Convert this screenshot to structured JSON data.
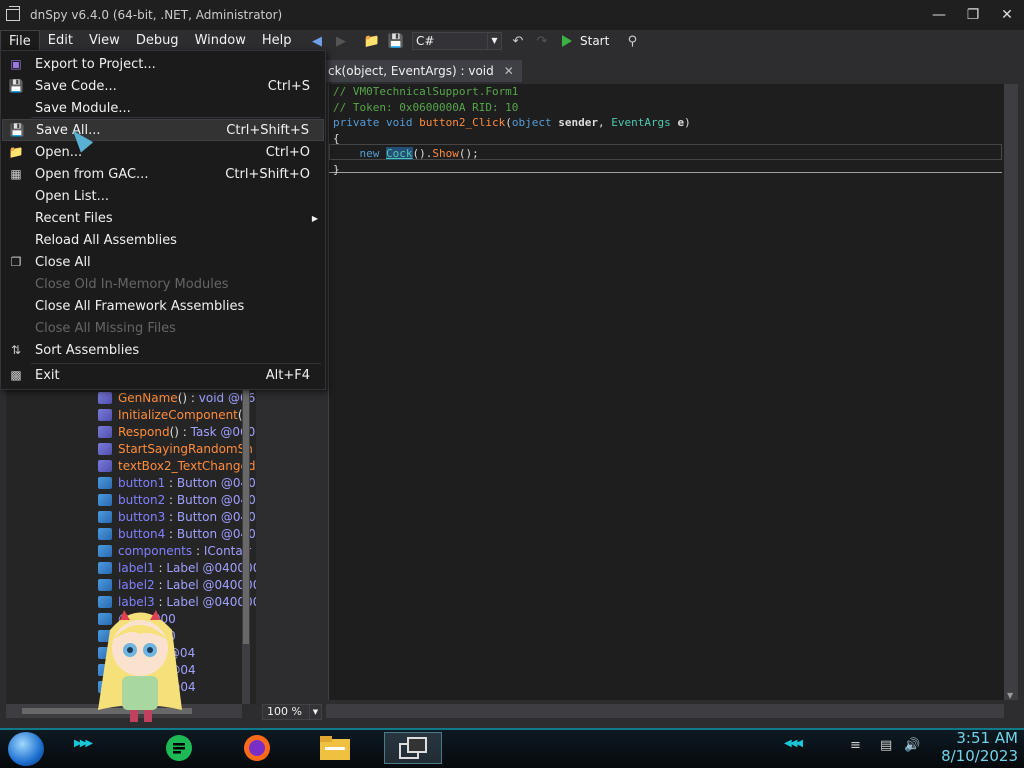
{
  "window": {
    "title": "dnSpy v6.4.0 (64-bit, .NET, Administrator)"
  },
  "menubar": [
    "File",
    "Edit",
    "View",
    "Debug",
    "Window",
    "Help"
  ],
  "toolbar": {
    "language": "C#",
    "start_label": "Start"
  },
  "document_tab": {
    "label": "ck(object, EventArgs) : void",
    "close": "✕"
  },
  "file_menu": [
    {
      "label": "Export to Project...",
      "shortcut": "",
      "icon": "export-icon",
      "state": "normal"
    },
    {
      "label": "Save Code...",
      "shortcut": "Ctrl+S",
      "icon": "save-icon",
      "state": "normal"
    },
    {
      "label": "Save Module...",
      "shortcut": "",
      "icon": "",
      "state": "normal"
    },
    {
      "label": "Save All...",
      "shortcut": "Ctrl+Shift+S",
      "icon": "save-all-icon",
      "state": "hover"
    },
    {
      "label": "Open...",
      "shortcut": "Ctrl+O",
      "icon": "open-folder-icon",
      "state": "normal"
    },
    {
      "label": "Open from GAC...",
      "shortcut": "Ctrl+Shift+O",
      "icon": "library-icon",
      "state": "normal"
    },
    {
      "label": "Open List...",
      "shortcut": "",
      "icon": "",
      "state": "normal"
    },
    {
      "label": "Recent Files",
      "shortcut": "",
      "icon": "",
      "state": "submenu"
    },
    {
      "label": "Reload All Assemblies",
      "shortcut": "",
      "icon": "",
      "state": "normal"
    },
    {
      "label": "Close All",
      "shortcut": "",
      "icon": "close-all-icon",
      "state": "normal"
    },
    {
      "label": "Close Old In-Memory Modules",
      "shortcut": "",
      "icon": "",
      "state": "disabled"
    },
    {
      "label": "Close All Framework Assemblies",
      "shortcut": "",
      "icon": "",
      "state": "normal"
    },
    {
      "label": "Close All Missing Files",
      "shortcut": "",
      "icon": "",
      "state": "disabled"
    },
    {
      "label": "Sort Assemblies",
      "shortcut": "",
      "icon": "sort-icon",
      "state": "normal"
    },
    {
      "label": "Exit",
      "shortcut": "Alt+F4",
      "icon": "exit-icon",
      "state": "normal"
    }
  ],
  "code": {
    "line1": "// VM0TechnicalSupport.Form1",
    "line2": "// Token: 0x0600000A RID: 10",
    "kw_private": "private",
    "kw_void": "void",
    "method_name": "button2_Click",
    "kw_object": "object",
    "param_sender": "sender",
    "type_eventargs": "EventArgs",
    "param_e": "e",
    "brace_open": "{",
    "kw_new": "new",
    "type_cock": "Cock",
    "call_show": "Show",
    "brace_close": "}"
  },
  "tree_items": [
    {
      "name": "GenName",
      "suffix": "() : ",
      "type": "void @06",
      "kind": "method"
    },
    {
      "name": "InitializeComponent",
      "suffix": "()",
      "type": "",
      "kind": "method"
    },
    {
      "name": "Respond",
      "suffix": "() : ",
      "type": "Task @060",
      "kind": "method"
    },
    {
      "name": "StartSayingRandomSh",
      "suffix": "",
      "type": "",
      "kind": "method"
    },
    {
      "name": "textBox2_TextChanged",
      "suffix": "",
      "type": "",
      "kind": "method"
    },
    {
      "name": "button1",
      "suffix": " : ",
      "type": "Button @040",
      "kind": "field"
    },
    {
      "name": "button2",
      "suffix": " : ",
      "type": "Button @040",
      "kind": "field"
    },
    {
      "name": "button3",
      "suffix": " : ",
      "type": "Button @040",
      "kind": "field"
    },
    {
      "name": "button4",
      "suffix": " : ",
      "type": "Button @040",
      "kind": "field"
    },
    {
      "name": "components",
      "suffix": " : ",
      "type": "IContair",
      "kind": "field"
    },
    {
      "name": "label1",
      "suffix": " : ",
      "type": "Label @040000",
      "kind": "field"
    },
    {
      "name": "label2",
      "suffix": " : ",
      "type": "Label @040000",
      "kind": "field"
    },
    {
      "name": "label3",
      "suffix": " : ",
      "type": "Label @040000",
      "kind": "field"
    },
    {
      "name": "",
      "suffix": "",
      "type": "@040000",
      "kind": "field"
    },
    {
      "name": "",
      "suffix": "",
      "type": "@040000",
      "kind": "field"
    },
    {
      "name": "",
      "suffix": " : ",
      "type": "string @04",
      "kind": "field"
    },
    {
      "name": "",
      "suffix": "",
      "type": "TextBox @04",
      "kind": "field"
    },
    {
      "name": "",
      "suffix": "",
      "type": "TextBox @04",
      "kind": "field"
    }
  ],
  "zoom": "100 %",
  "taskbar": {
    "time": "3:51 AM",
    "date": "8/10/2023"
  }
}
